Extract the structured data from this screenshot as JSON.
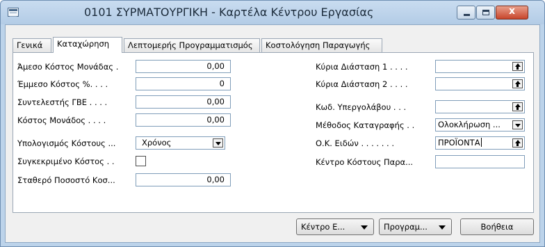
{
  "window": {
    "title": "0101 ΣΥΡΜΑΤΟΥΡΓΙΚΗ - Καρτέλα Κέντρου Εργασίας",
    "close_glyph": "x",
    "app_icon": "form-icon"
  },
  "tabs": [
    {
      "label": "Γενικά",
      "active": false
    },
    {
      "label": "Καταχώρηση",
      "active": true
    },
    {
      "label": "Λεπτομερής Προγραμματισμός",
      "active": false
    },
    {
      "label": "Κοστολόγηση Παραγωγής",
      "active": false
    }
  ],
  "left_fields": {
    "direct_unit_cost": {
      "label": "Άμεσο Κόστος Μονάδας .",
      "value": "0,00"
    },
    "indirect_cost_pct": {
      "label": "Έμμεσο Κόστος %. . . .",
      "value": "0"
    },
    "overhead_rate": {
      "label": "Συντελεστής ΓΒΕ . . . .",
      "value": "0,00"
    },
    "unit_cost": {
      "label": "Κόστος Μονάδος . . . .",
      "value": "0,00"
    },
    "unit_cost_calculation": {
      "label": "Υπολογισμός Κόστους ...",
      "value": "Χρόνος"
    },
    "specific_unit_cost": {
      "label": "Συγκεκριμένο Κόστος . .",
      "checked": false
    },
    "fixed_cost_pct": {
      "label": "Σταθερό Ποσοστό Κοσ...",
      "value": "0,00"
    }
  },
  "right_fields": {
    "dimension_1": {
      "label": "Κύρια Διάσταση 1 . . . .",
      "value": ""
    },
    "dimension_2": {
      "label": "Κύρια Διάσταση 2 . . . .",
      "value": ""
    },
    "subcontractor_no": {
      "label": "Κωδ. Υπεργολάβου . . .",
      "value": ""
    },
    "flushing_method": {
      "label": "Μέθοδος Καταγραφής . .",
      "value": "Ολοκλήρωση ..."
    },
    "gen_prod_posting_group": {
      "label": "Ο.Κ. Ειδών . . . . . . .",
      "value": "ΠΡΟΪΟΝΤΑ"
    },
    "cost_center": {
      "label": "Κέντρο Κόστους Παρα...",
      "value": ""
    }
  },
  "buttons": {
    "work_center": "Κέντρο Ε...",
    "schedule": "Προγραμ...",
    "help": "Βοήθεια"
  },
  "colors": {
    "frame": "#bcd3ea",
    "close_button": "#c8462c",
    "client": "#f0f0f0",
    "field_border": "#7f9db9"
  }
}
